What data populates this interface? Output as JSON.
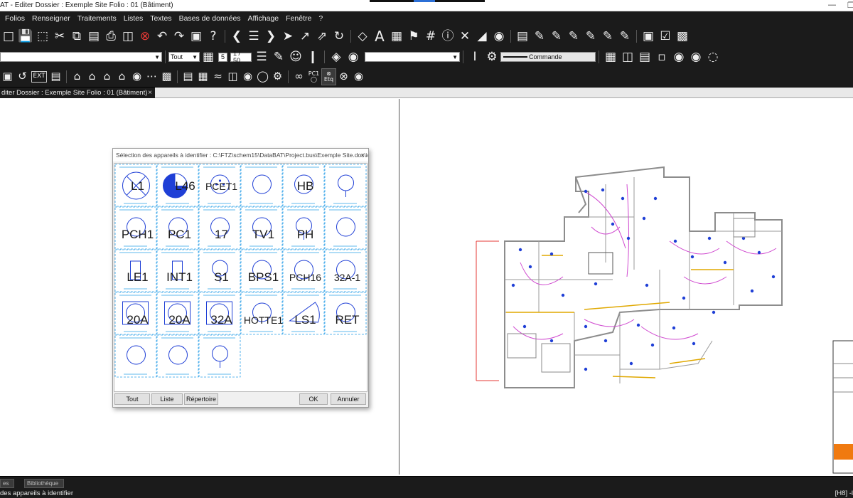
{
  "window": {
    "title": "AT - Editer  Dossier : Exemple Site  Folio : 01  (Bâtiment)",
    "controls": [
      "—",
      "❐"
    ]
  },
  "menu": [
    "Folios",
    "Renseigner",
    "Traitements",
    "Listes",
    "Textes",
    "Bases de données",
    "Affichage",
    "Fenêtre",
    "?"
  ],
  "toolbar2": {
    "filter_value": "Tout",
    "grid_number": "5",
    "scale": "1 / 50",
    "command_label": "Commande"
  },
  "doc_tab": {
    "label": "diter  Dossier : Exemple Site  Folio : 01  (Bâtiment)",
    "close": "×"
  },
  "dialog": {
    "title": "Sélection des appareils à identifier : C:\\FTZ\\schem15\\DataBAT\\Project.bus\\Exemple Site.dos\\id...",
    "close": "×",
    "symbols": [
      "L1",
      "L46",
      "PCET1",
      "",
      "HB",
      "",
      "PCH1",
      "PC1",
      "17",
      "TV1",
      "PH",
      "",
      "LE1",
      "INT1",
      "S1",
      "BPS1",
      "PCH16",
      "32A-1",
      "20A",
      "20A",
      "32A",
      "HOTTE1",
      "LS1",
      "RET",
      "",
      "",
      ""
    ],
    "buttons": {
      "all": "Tout",
      "list": "Liste",
      "directory": "Répertoire",
      "ok": "OK",
      "cancel": "Annuler"
    }
  },
  "toolbar3": {
    "ext_label": "EXT",
    "pc_label": "PC1",
    "etq_label": "Etq"
  },
  "status": {
    "tabs": [
      "es",
      "Bibliothèque"
    ],
    "message": "des appareils à identifier",
    "right": "[H8] -l"
  }
}
